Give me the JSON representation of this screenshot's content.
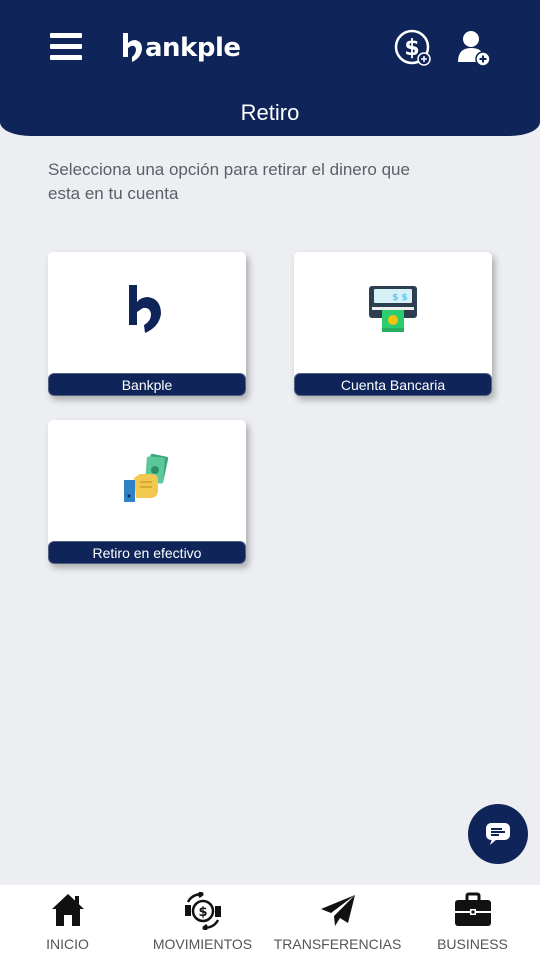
{
  "header": {
    "menu_icon": "hamburger-menu-icon",
    "logo_text": "ankple",
    "money_icon": "dollar-add-icon",
    "user_icon": "add-user-icon",
    "title": "Retiro"
  },
  "intro": "Selecciona una opción para retirar el dinero que esta en tu cuenta",
  "options": [
    {
      "label": "Bankple",
      "icon": "bankple-logo-icon"
    },
    {
      "label": "Cuenta Bancaria",
      "icon": "atm-icon"
    },
    {
      "label": "Retiro en efectivo",
      "icon": "cash-hand-icon"
    }
  ],
  "chat_icon": "chat-icon",
  "bottom_nav": [
    {
      "label": "INICIO",
      "icon": "home-icon"
    },
    {
      "label": "MOVIMIENTOS",
      "icon": "money-exchange-icon"
    },
    {
      "label": "TRANSFERENCIAS",
      "icon": "paper-plane-icon"
    },
    {
      "label": "BUSINESS",
      "icon": "briefcase-icon"
    }
  ],
  "colors": {
    "primary": "#0f2459",
    "background": "#eceef1",
    "text_gray": "#5a5f68"
  }
}
